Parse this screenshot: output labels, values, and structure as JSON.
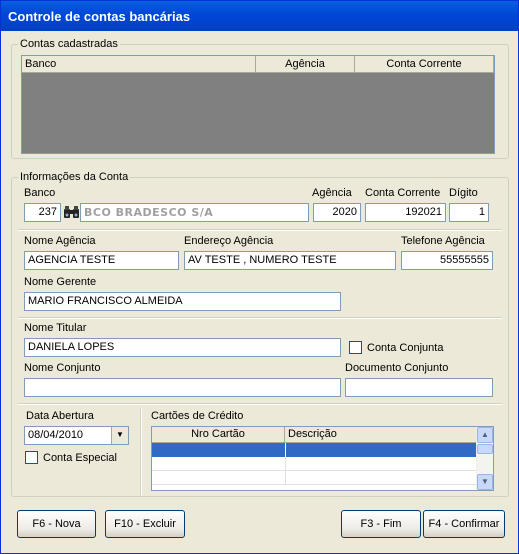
{
  "window": {
    "title": "Controle de contas bancárias"
  },
  "accounts": {
    "legend": "Contas cadastradas",
    "columns": [
      "Banco",
      "Agência",
      "Conta Corrente"
    ]
  },
  "info": {
    "legend": "Informações da Conta",
    "banco_label": "Banco",
    "banco_code": "237",
    "banco_name": "BCO BRADESCO S/A",
    "agencia_label": "Agência",
    "agencia_value": "2020",
    "conta_label": "Conta Corrente",
    "conta_value": "192021",
    "digito_label": "Dígito",
    "digito_value": "1",
    "nome_agencia_label": "Nome Agência",
    "nome_agencia_value": "AGENCIA TESTE",
    "endereco_label": "Endereço Agência",
    "endereco_value": "AV TESTE , NUMERO TESTE",
    "telefone_label": "Telefone Agência",
    "telefone_value": "55555555",
    "gerente_label": "Nome Gerente",
    "gerente_value": "MARIO FRANCISCO ALMEIDA",
    "titular_label": "Nome Titular",
    "titular_value": "DANIELA LOPES",
    "conjunta_label": "Conta Conjunta",
    "nome_conjunto_label": "Nome Conjunto",
    "nome_conjunto_value": "",
    "doc_conjunto_label": "Documento Conjunto",
    "doc_conjunto_value": "",
    "data_abertura_label": "Data Abertura",
    "data_abertura_value": "08/04/2010",
    "especial_label": "Conta Especial",
    "cartoes_label": "Cartões de Crédito",
    "cartoes_columns": [
      "Nro Cartão",
      "Descrição"
    ]
  },
  "buttons": {
    "nova": "F6 - Nova",
    "excluir": "F10 - Excluir",
    "fim": "F3 - Fim",
    "confirmar": "F4 - Confirmar"
  },
  "icons": [
    "binoculars-icon",
    "dropdown-arrow-icon",
    "scroll-up-icon",
    "scroll-down-icon"
  ],
  "colors": {
    "titlebar": "#0046d5",
    "selection": "#316ac5",
    "window_bg": "#ece9d8"
  }
}
